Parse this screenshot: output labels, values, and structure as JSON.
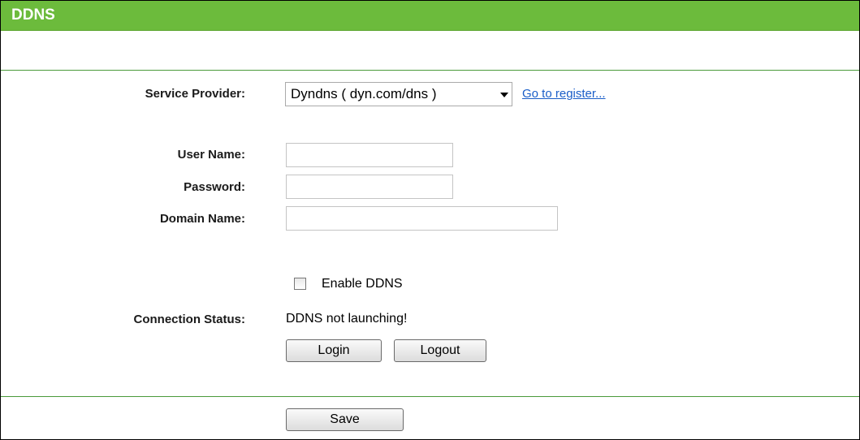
{
  "header": {
    "title": "DDNS"
  },
  "form": {
    "service_provider": {
      "label": "Service Provider:",
      "selected": "Dyndns ( dyn.com/dns )",
      "register_link": "Go to register..."
    },
    "user_name": {
      "label": "User Name:",
      "value": ""
    },
    "password": {
      "label": "Password:",
      "value": ""
    },
    "domain_name": {
      "label": "Domain Name:",
      "value": ""
    },
    "enable_ddns": {
      "label": "Enable DDNS",
      "checked": false
    },
    "connection_status": {
      "label": "Connection Status:",
      "value": "DDNS not launching!"
    },
    "buttons": {
      "login": "Login",
      "logout": "Logout",
      "save": "Save"
    }
  },
  "colors": {
    "header_bg": "#6cbb3c",
    "rule": "#4a9a3a",
    "link": "#1a5ec8"
  }
}
